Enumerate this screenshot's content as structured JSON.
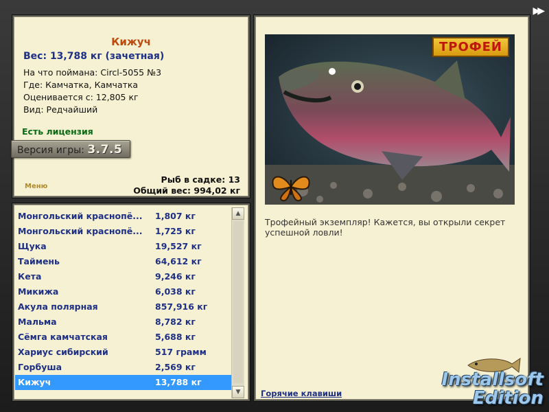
{
  "top_right_arrows": "▶▶",
  "info": {
    "fish_name": "Кижуч",
    "weight_line": "Вес: 13,788 кг (зачетная)",
    "lines": [
      "На что поймана: Circl-5055 №3",
      "Где: Камчатка, Камчатка",
      "Оценивается с: 12,805 кг",
      "Вид: Редчайший"
    ],
    "license": "Есть лицензия",
    "version_prefix": "Версия игры: ",
    "version": "3.7.5",
    "menu_link": "Меню",
    "fish_count": "Рыб в садке: 13",
    "total_weight": "Общий вес: 994,02 кг"
  },
  "catch_list": [
    {
      "name": "Монгольский краснопё...",
      "weight": "1,807 кг"
    },
    {
      "name": "Монгольский краснопё...",
      "weight": "1,725 кг"
    },
    {
      "name": "Щука",
      "weight": "19,527 кг"
    },
    {
      "name": "Таймень",
      "weight": "64,612 кг"
    },
    {
      "name": "Кета",
      "weight": "9,246 кг"
    },
    {
      "name": "Микижа",
      "weight": "6,038 кг"
    },
    {
      "name": "Акула полярная",
      "weight": "857,916 кг"
    },
    {
      "name": "Мальма",
      "weight": "8,782 кг"
    },
    {
      "name": "Сёмга камчатская",
      "weight": "5,688 кг"
    },
    {
      "name": "Хариус сибирский",
      "weight": "517 грамм"
    },
    {
      "name": "Горбуша",
      "weight": "2,569 кг"
    },
    {
      "name": "Кижуч",
      "weight": "13,788 кг",
      "selected": true
    }
  ],
  "detail": {
    "trophy_badge": "ТРОФЕЙ",
    "trophy_message": "Трофейный экземпляр! Кажется, вы открыли секрет успешной ловли!",
    "hotkeys_link": "Горячие клавиши"
  },
  "watermark": {
    "line1": "Installsoft",
    "line2": "Edition"
  },
  "colors": {
    "panel_bg": "#f5f1d2",
    "accent_blue": "#1e2f86",
    "title_orange": "#c0490c",
    "selection": "#3399ff",
    "license_green": "#0b6a16"
  }
}
